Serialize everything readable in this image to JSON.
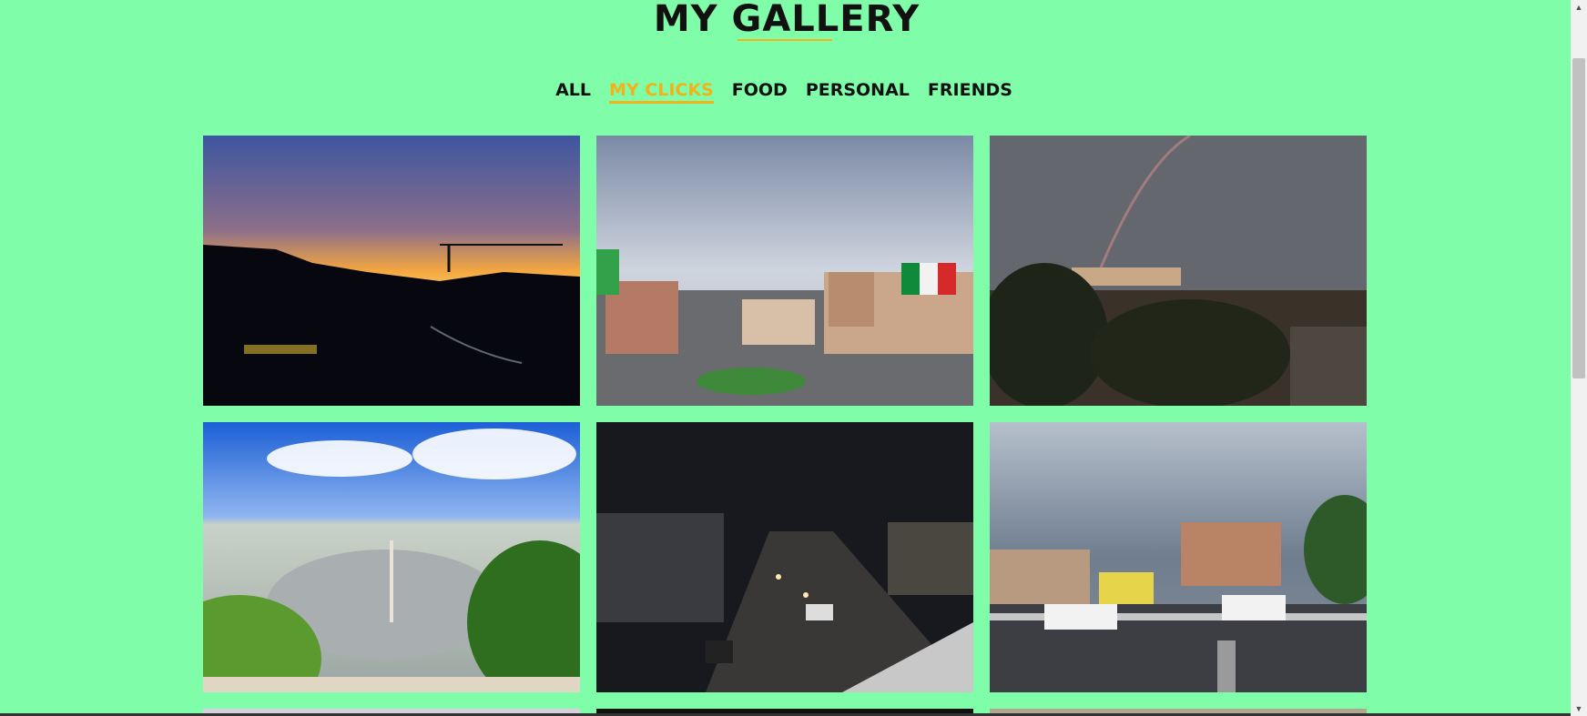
{
  "page": {
    "title": "MY GALLERY",
    "background": "#80fda8",
    "accent": "#f3b21a"
  },
  "filters": [
    {
      "label": "ALL",
      "active": false
    },
    {
      "label": "MY CLICKS",
      "active": true
    },
    {
      "label": "FOOD",
      "active": false
    },
    {
      "label": "PERSONAL",
      "active": false
    },
    {
      "label": "FRIENDS",
      "active": false
    }
  ],
  "gallery": {
    "photos": [
      {
        "subject": "sunset-city-crane"
      },
      {
        "subject": "piazza-venezia-flags"
      },
      {
        "subject": "rainbow-rooftops"
      },
      {
        "subject": "piazza-del-popolo"
      },
      {
        "subject": "night-street"
      },
      {
        "subject": "cloudy-street-cars"
      },
      {
        "subject": "partial-row"
      },
      {
        "subject": "partial-row"
      },
      {
        "subject": "partial-row"
      }
    ]
  }
}
